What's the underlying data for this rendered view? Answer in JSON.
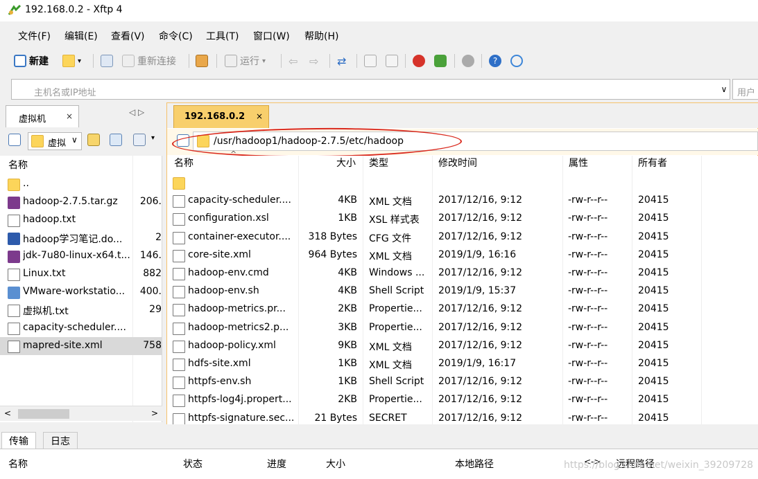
{
  "window": {
    "title": "192.168.0.2 - Xftp 4"
  },
  "menu": [
    "文件(F)",
    "编辑(E)",
    "查看(V)",
    "命令(C)",
    "工具(T)",
    "窗口(W)",
    "帮助(H)"
  ],
  "toolbar": {
    "new_label": "新建",
    "reconnect_label": "重新连接",
    "run_label": "运行"
  },
  "address": {
    "placeholder": "主机名或IP地址",
    "user_placeholder": "用户"
  },
  "left_tab": {
    "label": "虚拟机",
    "close": "×",
    "arrows": "◁ ▷",
    "path_label": "虚拟"
  },
  "left_list": {
    "header": "名称",
    "rows": [
      {
        "name": "..",
        "size": ""
      },
      {
        "name": "hadoop-2.7.5.tar.gz",
        "size": "206."
      },
      {
        "name": "hadoop.txt",
        "size": ""
      },
      {
        "name": "hadoop学习笔记.do...",
        "size": "2"
      },
      {
        "name": "jdk-7u80-linux-x64.t...",
        "size": "146."
      },
      {
        "name": "Linux.txt",
        "size": "882"
      },
      {
        "name": "VMware-workstatio...",
        "size": "400."
      },
      {
        "name": "虚拟机.txt",
        "size": "29"
      },
      {
        "name": "capacity-scheduler....",
        "size": ""
      },
      {
        "name": "mapred-site.xml",
        "size": "758"
      }
    ]
  },
  "right_tab": {
    "label": "192.168.0.2",
    "close": "×"
  },
  "right_path": "/usr/hadoop1/hadoop-2.7.5/etc/hadoop",
  "right_list": {
    "headers": {
      "name": "名称",
      "size": "大小",
      "type": "类型",
      "time": "修改时间",
      "attr": "属性",
      "owner": "所有者"
    },
    "rows": [
      {
        "name": "",
        "size": "",
        "type": "",
        "time": "",
        "attr": "",
        "owner": ""
      },
      {
        "name": "capacity-scheduler....",
        "size": "4KB",
        "type": "XML 文档",
        "time": "2017/12/16, 9:12",
        "attr": "-rw-r--r--",
        "owner": "20415"
      },
      {
        "name": "configuration.xsl",
        "size": "1KB",
        "type": "XSL 样式表",
        "time": "2017/12/16, 9:12",
        "attr": "-rw-r--r--",
        "owner": "20415"
      },
      {
        "name": "container-executor....",
        "size": "318 Bytes",
        "type": "CFG 文件",
        "time": "2017/12/16, 9:12",
        "attr": "-rw-r--r--",
        "owner": "20415"
      },
      {
        "name": "core-site.xml",
        "size": "964 Bytes",
        "type": "XML 文档",
        "time": "2019/1/9, 16:16",
        "attr": "-rw-r--r--",
        "owner": "20415"
      },
      {
        "name": "hadoop-env.cmd",
        "size": "4KB",
        "type": "Windows ...",
        "time": "2017/12/16, 9:12",
        "attr": "-rw-r--r--",
        "owner": "20415"
      },
      {
        "name": "hadoop-env.sh",
        "size": "4KB",
        "type": "Shell Script",
        "time": "2019/1/9, 15:37",
        "attr": "-rw-r--r--",
        "owner": "20415"
      },
      {
        "name": "hadoop-metrics.pr...",
        "size": "2KB",
        "type": "Propertie...",
        "time": "2017/12/16, 9:12",
        "attr": "-rw-r--r--",
        "owner": "20415"
      },
      {
        "name": "hadoop-metrics2.p...",
        "size": "3KB",
        "type": "Propertie...",
        "time": "2017/12/16, 9:12",
        "attr": "-rw-r--r--",
        "owner": "20415"
      },
      {
        "name": "hadoop-policy.xml",
        "size": "9KB",
        "type": "XML 文档",
        "time": "2017/12/16, 9:12",
        "attr": "-rw-r--r--",
        "owner": "20415"
      },
      {
        "name": "hdfs-site.xml",
        "size": "1KB",
        "type": "XML 文档",
        "time": "2019/1/9, 16:17",
        "attr": "-rw-r--r--",
        "owner": "20415"
      },
      {
        "name": "httpfs-env.sh",
        "size": "1KB",
        "type": "Shell Script",
        "time": "2017/12/16, 9:12",
        "attr": "-rw-r--r--",
        "owner": "20415"
      },
      {
        "name": "httpfs-log4j.propert...",
        "size": "2KB",
        "type": "Propertie...",
        "time": "2017/12/16, 9:12",
        "attr": "-rw-r--r--",
        "owner": "20415"
      },
      {
        "name": "httpfs-signature.sec...",
        "size": "21 Bytes",
        "type": "SECRET",
        "time": "2017/12/16, 9:12",
        "attr": "-rw-r--r--",
        "owner": "20415"
      }
    ]
  },
  "bottom": {
    "tabs": [
      "传输",
      "日志"
    ],
    "headers": {
      "name": "名称",
      "status": "状态",
      "progress": "进度",
      "size": "大小",
      "local": "本地路径",
      "arrow": "<->",
      "remote": "远程路径"
    }
  },
  "watermark": "https://blog.csdn.net/weixin_39209728",
  "colors": {
    "tab_active": "#f8cf6c",
    "annotation_circle": "#d9281c",
    "folder": "#fcd55a"
  }
}
